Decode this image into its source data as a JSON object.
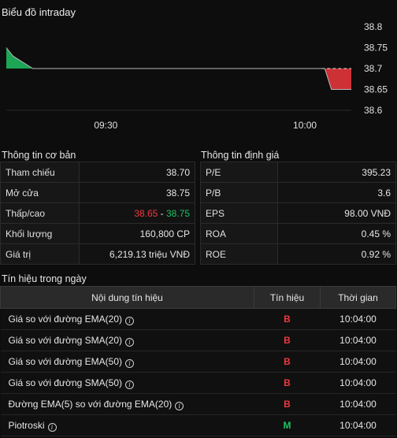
{
  "chart_title": "Biểu đồ intraday",
  "chart_data": {
    "type": "area",
    "reference": 38.7,
    "x_ticks": [
      "09:30",
      "10:00"
    ],
    "y_ticks": [
      38.8,
      38.75,
      38.7,
      38.65,
      38.6
    ],
    "ylim": [
      38.6,
      38.8
    ],
    "series": [
      {
        "values": [
          {
            "x": "09:15",
            "y": 38.75
          },
          {
            "x": "09:16",
            "y": 38.73
          },
          {
            "x": "09:19",
            "y": 38.7
          },
          {
            "x": "10:03",
            "y": 38.7
          },
          {
            "x": "10:04",
            "y": 38.65
          },
          {
            "x": "10:07",
            "y": 38.65
          }
        ]
      }
    ],
    "colors": {
      "up": "#1ec162",
      "down": "#f0383e",
      "grid": "#2a2a2a"
    }
  },
  "basic_info": {
    "title": "Thông tin cơ bản",
    "rows": [
      {
        "label": "Tham chiếu",
        "value": "38.70",
        "color": "#f5a623"
      },
      {
        "label": "Mở cửa",
        "value": "38.75",
        "color": "#1ec162"
      },
      {
        "label": "Thấp/cao",
        "low": "38.65",
        "sep": " - ",
        "high": "38.75"
      },
      {
        "label": "Khối lượng",
        "value": "160,800 CP"
      },
      {
        "label": "Giá trị",
        "value": "6,219.13 triệu VNĐ"
      }
    ]
  },
  "valuation_info": {
    "title": "Thông tin định giá",
    "rows": [
      {
        "label": "P/E",
        "value": "395.23"
      },
      {
        "label": "P/B",
        "value": "3.6"
      },
      {
        "label": "EPS",
        "value": "98.00 VNĐ"
      },
      {
        "label": "ROA",
        "value": "0.45 %"
      },
      {
        "label": "ROE",
        "value": "0.92 %"
      }
    ]
  },
  "signals": {
    "title": "Tín hiệu trong ngày",
    "headers": [
      "Nội dung tín hiệu",
      "Tín hiệu",
      "Thời gian"
    ],
    "rows": [
      {
        "desc": "Giá so với đường EMA(20)",
        "signal": "B",
        "time": "10:04:00",
        "icon": "info-icon"
      },
      {
        "desc": "Giá so với đường SMA(20)",
        "signal": "B",
        "time": "10:04:00",
        "icon": "info-icon"
      },
      {
        "desc": "Giá so với đường EMA(50)",
        "signal": "B",
        "time": "10:04:00",
        "icon": "info-icon"
      },
      {
        "desc": "Giá so với đường SMA(50)",
        "signal": "B",
        "time": "10:04:00",
        "icon": "info-icon"
      },
      {
        "desc": "Đường EMA(5) so với đường EMA(20)",
        "signal": "B",
        "time": "10:04:00",
        "icon": "info-icon"
      },
      {
        "desc": "Piotroski",
        "signal": "M",
        "time": "10:04:00",
        "icon": "info-icon"
      }
    ],
    "signal_colors": {
      "B": "#f0383e",
      "M": "#1ec162"
    }
  }
}
